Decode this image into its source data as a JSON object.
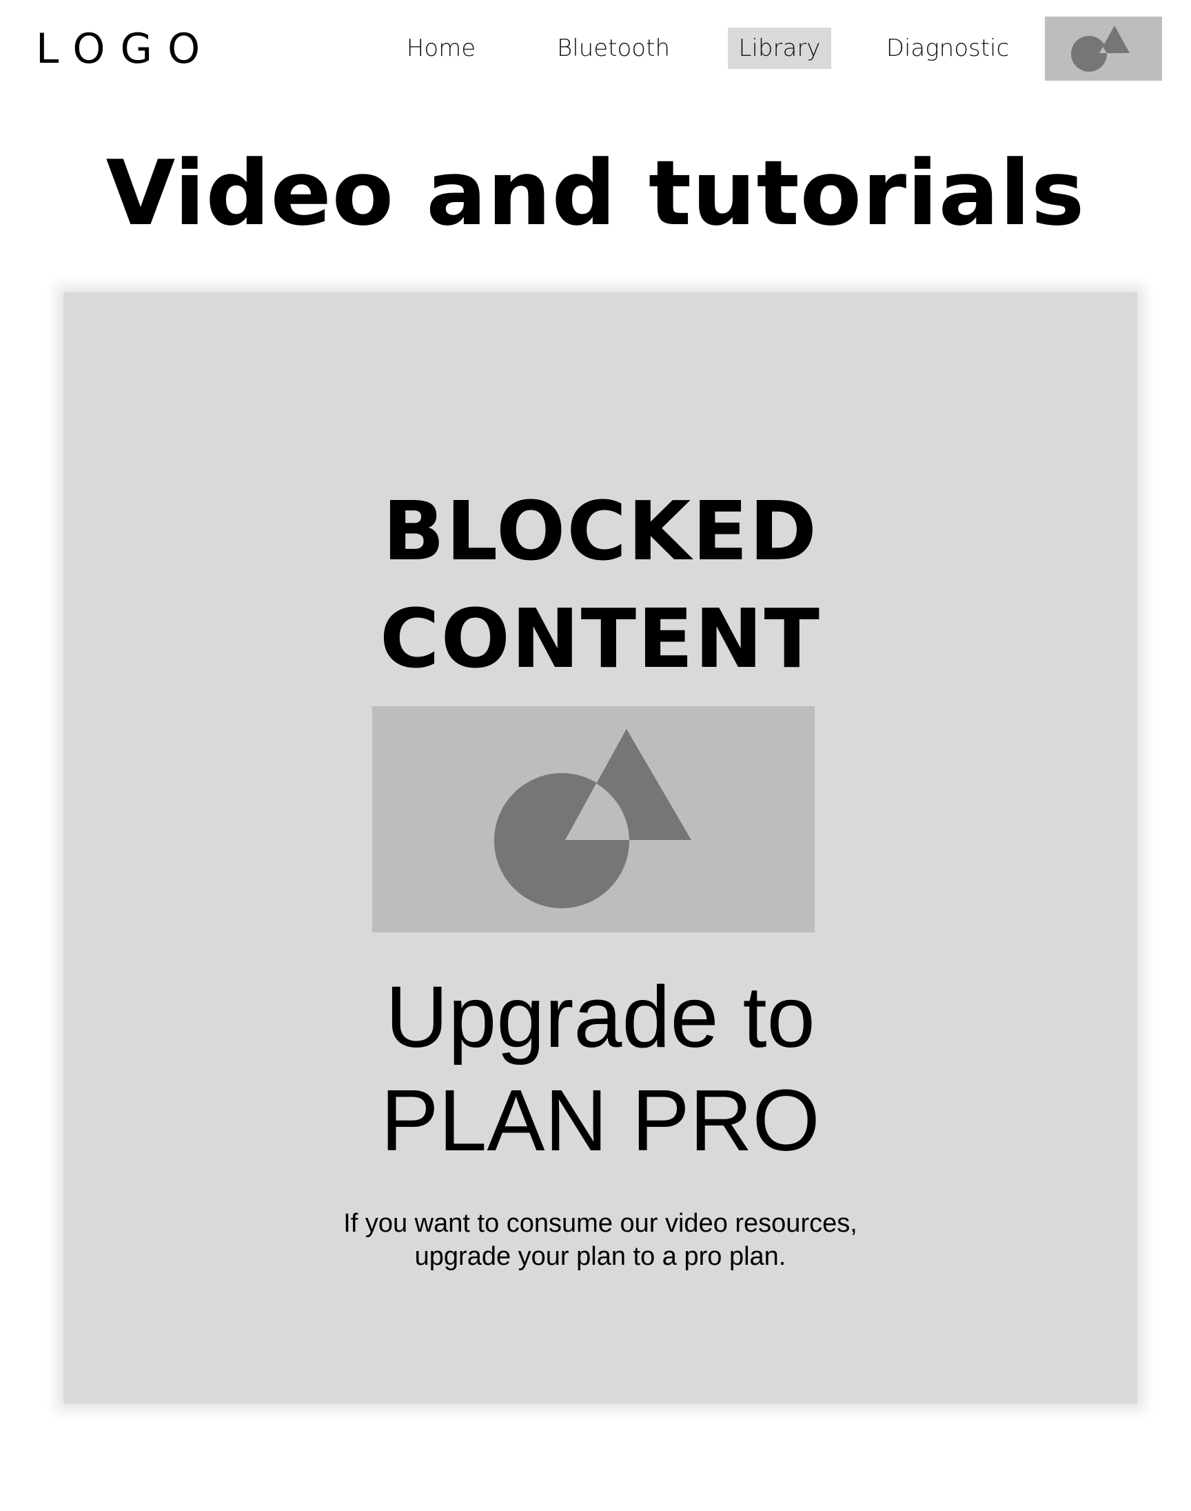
{
  "header": {
    "logo": "LOGO",
    "nav": {
      "home": "Home",
      "bluetooth": "Bluetooth",
      "library": "Library",
      "diagnostic": "Diagnostic"
    },
    "avatar_icon": "image-placeholder-icon"
  },
  "page": {
    "title": "Video and tutorials"
  },
  "card": {
    "blocked_line1": "BLOCKED",
    "blocked_line2": "CONTENT",
    "image_icon": "image-placeholder-icon",
    "upgrade_line1": "Upgrade to",
    "upgrade_line2": "PLAN PRO",
    "desc_line1": "If you want to consume our video resources,",
    "desc_line2": "upgrade your plan to a pro plan."
  },
  "colors": {
    "background": "#ffffff",
    "card": "#d9d9d9",
    "placeholder": "#bdbdbd",
    "placeholder_shape": "#767676",
    "nav_active": "#d9d9d9"
  }
}
